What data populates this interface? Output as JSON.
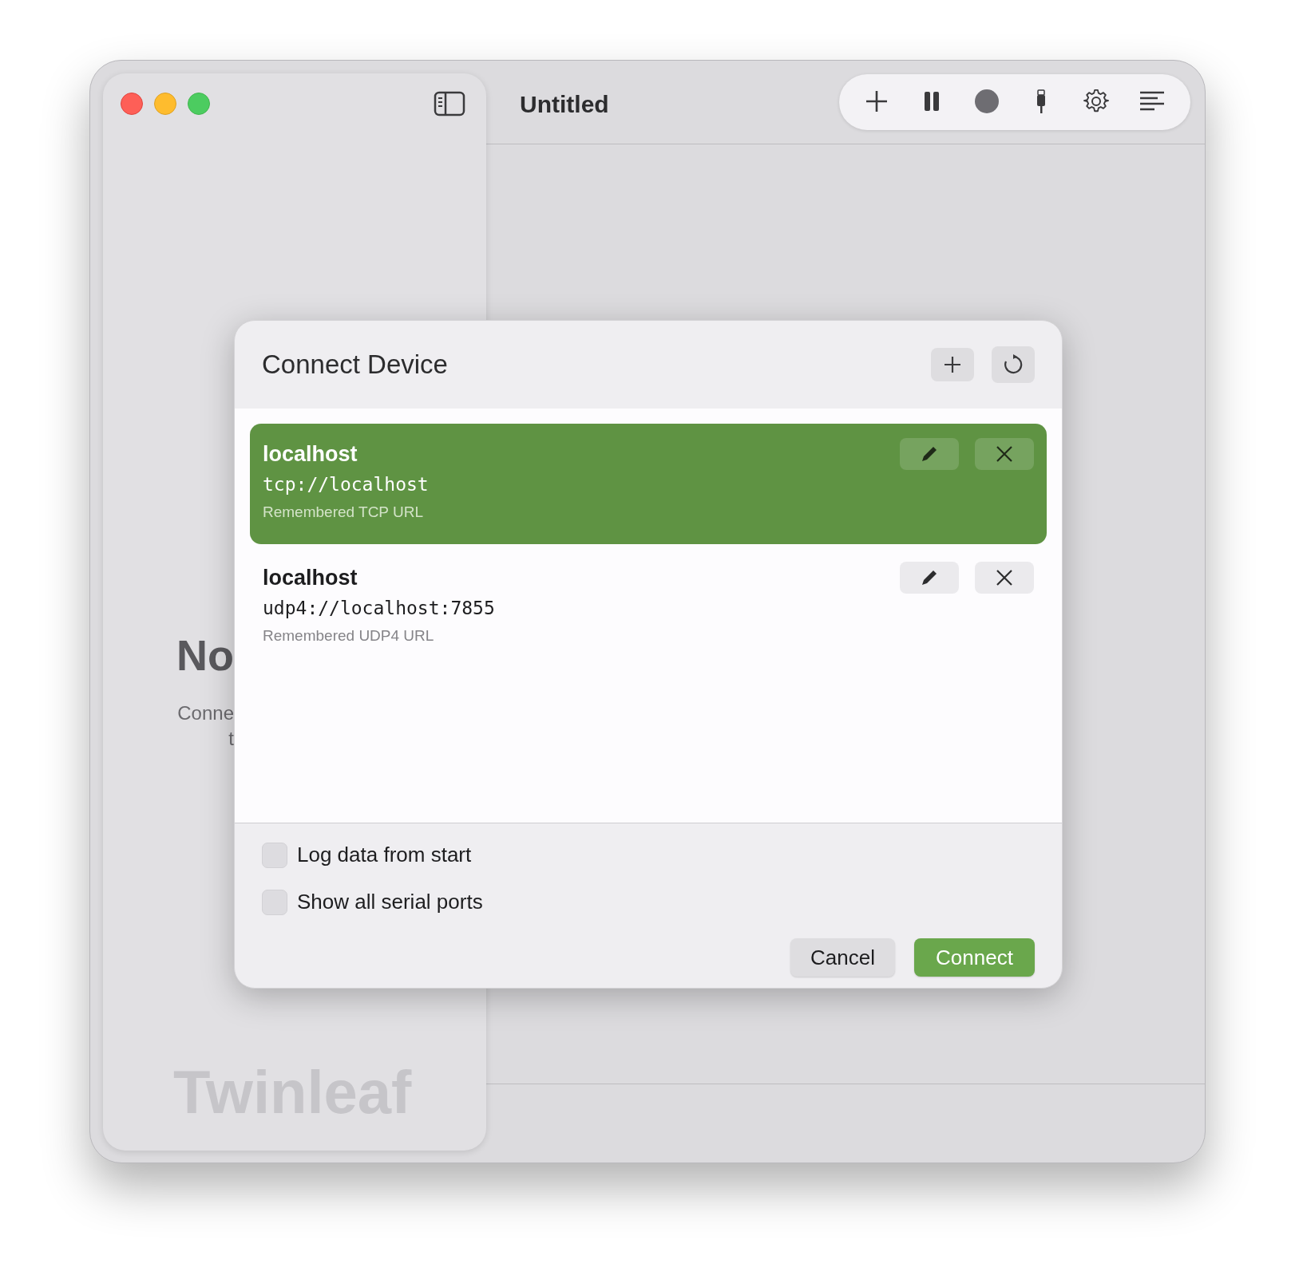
{
  "window": {
    "title": "Untitled"
  },
  "sidebar": {
    "empty_title": "No",
    "empty_text_lines": [
      "Conne",
      "t"
    ],
    "logo": "Twinleaf"
  },
  "toolbar": {
    "buttons": [
      {
        "kind": "add"
      },
      {
        "kind": "pause"
      },
      {
        "kind": "record"
      },
      {
        "kind": "plug"
      },
      {
        "kind": "settings"
      },
      {
        "kind": "list"
      }
    ]
  },
  "dialog": {
    "title": "Connect Device",
    "devices": [
      {
        "name": "localhost",
        "url": "tcp://localhost",
        "note": "Remembered TCP URL",
        "selected": true
      },
      {
        "name": "localhost",
        "url": "udp4://localhost:7855",
        "note": "Remembered UDP4 URL",
        "selected": false
      }
    ],
    "options": [
      {
        "label": "Log data from start",
        "checked": false
      },
      {
        "label": "Show all serial ports",
        "checked": false
      }
    ],
    "buttons": [
      {
        "label": "Cancel",
        "kind": "secondary"
      },
      {
        "label": "Connect",
        "kind": "primary"
      }
    ]
  }
}
